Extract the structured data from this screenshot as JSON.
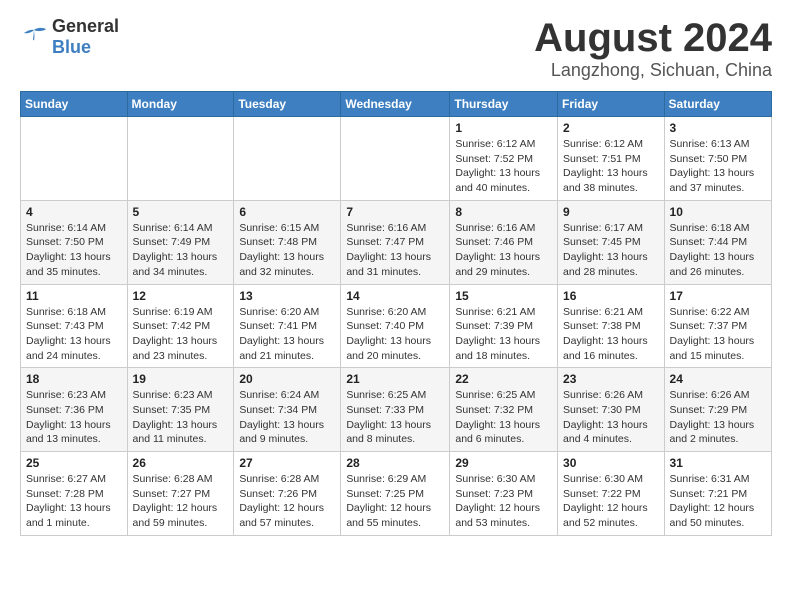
{
  "logo": {
    "general": "General",
    "blue": "Blue"
  },
  "title": "August 2024",
  "subtitle": "Langzhong, Sichuan, China",
  "days_of_week": [
    "Sunday",
    "Monday",
    "Tuesday",
    "Wednesday",
    "Thursday",
    "Friday",
    "Saturday"
  ],
  "weeks": [
    [
      {
        "day": "",
        "info": ""
      },
      {
        "day": "",
        "info": ""
      },
      {
        "day": "",
        "info": ""
      },
      {
        "day": "",
        "info": ""
      },
      {
        "day": "1",
        "info": "Sunrise: 6:12 AM\nSunset: 7:52 PM\nDaylight: 13 hours\nand 40 minutes."
      },
      {
        "day": "2",
        "info": "Sunrise: 6:12 AM\nSunset: 7:51 PM\nDaylight: 13 hours\nand 38 minutes."
      },
      {
        "day": "3",
        "info": "Sunrise: 6:13 AM\nSunset: 7:50 PM\nDaylight: 13 hours\nand 37 minutes."
      }
    ],
    [
      {
        "day": "4",
        "info": "Sunrise: 6:14 AM\nSunset: 7:50 PM\nDaylight: 13 hours\nand 35 minutes."
      },
      {
        "day": "5",
        "info": "Sunrise: 6:14 AM\nSunset: 7:49 PM\nDaylight: 13 hours\nand 34 minutes."
      },
      {
        "day": "6",
        "info": "Sunrise: 6:15 AM\nSunset: 7:48 PM\nDaylight: 13 hours\nand 32 minutes."
      },
      {
        "day": "7",
        "info": "Sunrise: 6:16 AM\nSunset: 7:47 PM\nDaylight: 13 hours\nand 31 minutes."
      },
      {
        "day": "8",
        "info": "Sunrise: 6:16 AM\nSunset: 7:46 PM\nDaylight: 13 hours\nand 29 minutes."
      },
      {
        "day": "9",
        "info": "Sunrise: 6:17 AM\nSunset: 7:45 PM\nDaylight: 13 hours\nand 28 minutes."
      },
      {
        "day": "10",
        "info": "Sunrise: 6:18 AM\nSunset: 7:44 PM\nDaylight: 13 hours\nand 26 minutes."
      }
    ],
    [
      {
        "day": "11",
        "info": "Sunrise: 6:18 AM\nSunset: 7:43 PM\nDaylight: 13 hours\nand 24 minutes."
      },
      {
        "day": "12",
        "info": "Sunrise: 6:19 AM\nSunset: 7:42 PM\nDaylight: 13 hours\nand 23 minutes."
      },
      {
        "day": "13",
        "info": "Sunrise: 6:20 AM\nSunset: 7:41 PM\nDaylight: 13 hours\nand 21 minutes."
      },
      {
        "day": "14",
        "info": "Sunrise: 6:20 AM\nSunset: 7:40 PM\nDaylight: 13 hours\nand 20 minutes."
      },
      {
        "day": "15",
        "info": "Sunrise: 6:21 AM\nSunset: 7:39 PM\nDaylight: 13 hours\nand 18 minutes."
      },
      {
        "day": "16",
        "info": "Sunrise: 6:21 AM\nSunset: 7:38 PM\nDaylight: 13 hours\nand 16 minutes."
      },
      {
        "day": "17",
        "info": "Sunrise: 6:22 AM\nSunset: 7:37 PM\nDaylight: 13 hours\nand 15 minutes."
      }
    ],
    [
      {
        "day": "18",
        "info": "Sunrise: 6:23 AM\nSunset: 7:36 PM\nDaylight: 13 hours\nand 13 minutes."
      },
      {
        "day": "19",
        "info": "Sunrise: 6:23 AM\nSunset: 7:35 PM\nDaylight: 13 hours\nand 11 minutes."
      },
      {
        "day": "20",
        "info": "Sunrise: 6:24 AM\nSunset: 7:34 PM\nDaylight: 13 hours\nand 9 minutes."
      },
      {
        "day": "21",
        "info": "Sunrise: 6:25 AM\nSunset: 7:33 PM\nDaylight: 13 hours\nand 8 minutes."
      },
      {
        "day": "22",
        "info": "Sunrise: 6:25 AM\nSunset: 7:32 PM\nDaylight: 13 hours\nand 6 minutes."
      },
      {
        "day": "23",
        "info": "Sunrise: 6:26 AM\nSunset: 7:30 PM\nDaylight: 13 hours\nand 4 minutes."
      },
      {
        "day": "24",
        "info": "Sunrise: 6:26 AM\nSunset: 7:29 PM\nDaylight: 13 hours\nand 2 minutes."
      }
    ],
    [
      {
        "day": "25",
        "info": "Sunrise: 6:27 AM\nSunset: 7:28 PM\nDaylight: 13 hours\nand 1 minute."
      },
      {
        "day": "26",
        "info": "Sunrise: 6:28 AM\nSunset: 7:27 PM\nDaylight: 12 hours\nand 59 minutes."
      },
      {
        "day": "27",
        "info": "Sunrise: 6:28 AM\nSunset: 7:26 PM\nDaylight: 12 hours\nand 57 minutes."
      },
      {
        "day": "28",
        "info": "Sunrise: 6:29 AM\nSunset: 7:25 PM\nDaylight: 12 hours\nand 55 minutes."
      },
      {
        "day": "29",
        "info": "Sunrise: 6:30 AM\nSunset: 7:23 PM\nDaylight: 12 hours\nand 53 minutes."
      },
      {
        "day": "30",
        "info": "Sunrise: 6:30 AM\nSunset: 7:22 PM\nDaylight: 12 hours\nand 52 minutes."
      },
      {
        "day": "31",
        "info": "Sunrise: 6:31 AM\nSunset: 7:21 PM\nDaylight: 12 hours\nand 50 minutes."
      }
    ]
  ]
}
